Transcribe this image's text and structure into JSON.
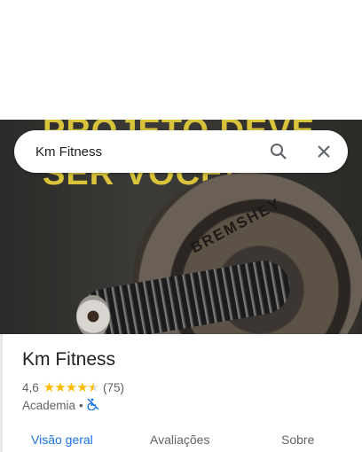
{
  "photo": {
    "line1": "PROJETO DEVE",
    "line2": "SER VOCÊ!",
    "plate_text": "BREMSHEY"
  },
  "search": {
    "value": "Km Fitness",
    "search_icon": "search-icon",
    "clear_icon": "close-icon"
  },
  "place": {
    "name": "Km Fitness",
    "rating": "4,6",
    "rating_value": 4.6,
    "reviews": "(75)",
    "category": "Academia",
    "separator": "•",
    "accessibility_icon": "no-wheelchair-icon"
  },
  "tabs": [
    {
      "label": "Visão geral",
      "active": true
    },
    {
      "label": "Avaliações"
    },
    {
      "label": "Sobre"
    }
  ],
  "colors": {
    "accent": "#1a73e8",
    "star": "#fbbc04"
  }
}
